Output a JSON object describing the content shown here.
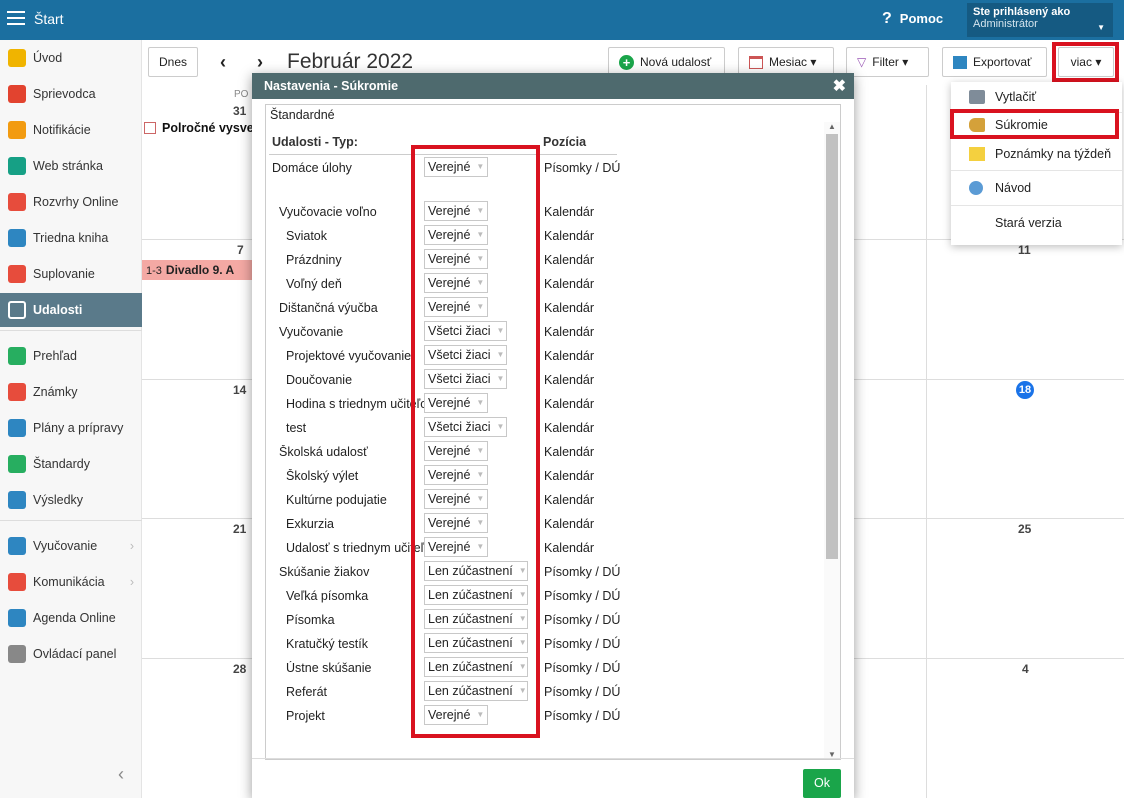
{
  "topbar": {
    "title": "Štart",
    "help": "Pomoc",
    "user_line1": "Ste prihlásený ako",
    "user_line2": "Administrátor"
  },
  "sidebar": {
    "items": [
      {
        "label": "Úvod",
        "icon": "star-icon",
        "color": "#f0b400"
      },
      {
        "label": "Sprievodca",
        "icon": "wand-icon",
        "color": "#e2432f"
      },
      {
        "label": "Notifikácie",
        "icon": "envelope-icon",
        "color": "#f29b11"
      },
      {
        "label": "Web stránka",
        "icon": "house-icon",
        "color": "#16a085"
      },
      {
        "label": "Rozvrhy Online",
        "icon": "grid-icon",
        "color": "#e74c3c"
      },
      {
        "label": "Triedna kniha",
        "icon": "book-icon",
        "color": "#2e86c1"
      },
      {
        "label": "Suplovanie",
        "icon": "person-icon",
        "color": "#e74c3c"
      },
      {
        "label": "Udalosti",
        "icon": "calendar-icon",
        "color": "#ffffff"
      },
      {
        "label": "Prehľad",
        "icon": "check-icon",
        "color": "#27ae60"
      },
      {
        "label": "Známky",
        "icon": "grade-icon",
        "color": "#e74c3c"
      },
      {
        "label": "Plány a prípravy",
        "icon": "briefcase-icon",
        "color": "#2e86c1"
      },
      {
        "label": "Štandardy",
        "icon": "shield-icon",
        "color": "#27ae60"
      },
      {
        "label": "Výsledky",
        "icon": "bar-chart-icon",
        "color": "#2e86c1"
      },
      {
        "label": "Vyučovanie",
        "icon": "open-book-icon",
        "color": "#2e86c1"
      },
      {
        "label": "Komunikácia",
        "icon": "chat-icon",
        "color": "#e74c3c"
      },
      {
        "label": "Agenda Online",
        "icon": "pen-icon",
        "color": "#2e86c1"
      },
      {
        "label": "Ovládací panel",
        "icon": "gear-icon",
        "color": "#888888"
      }
    ]
  },
  "toolbar": {
    "today": "Dnes",
    "month": "Február 2022",
    "new_event": "Nová udalosť",
    "view": "Mesiac ▾",
    "filter": "Filter ▾",
    "export": "Exportovať",
    "more": "viac ▾"
  },
  "calendar": {
    "day_header": "PO",
    "days": [
      "31",
      "7",
      "14",
      "21",
      "28",
      "11",
      "18",
      "25",
      "4"
    ],
    "event1": "Polročné vysve",
    "event2_time": "1-3",
    "event2": "Divadlo 9. A"
  },
  "menu": {
    "items": [
      "Vytlačiť",
      "Súkromie",
      "Poznámky na týždeň",
      "Návod",
      "Stará verzia"
    ]
  },
  "dialog": {
    "title": "Nastavenia - Súkromie",
    "section": "Štandardné",
    "col_type": "Udalosti - Typ:",
    "col_pos": "Pozícia",
    "rows": [
      {
        "label": "Domáce úlohy",
        "value": "Verejné",
        "pos": "Písomky / DÚ"
      },
      {
        "label": "Vyučovacie voľno",
        "value": "Verejné",
        "pos": "Kalendár"
      },
      {
        "label": "Sviatok",
        "value": "Verejné",
        "pos": "Kalendár"
      },
      {
        "label": "Prázdniny",
        "value": "Verejné",
        "pos": "Kalendár"
      },
      {
        "label": "Voľný deň",
        "value": "Verejné",
        "pos": "Kalendár"
      },
      {
        "label": "Dištančná výučba",
        "value": "Verejné",
        "pos": "Kalendár"
      },
      {
        "label": "Vyučovanie",
        "value": "Všetci žiaci",
        "pos": "Kalendár"
      },
      {
        "label": "Projektové vyučovanie",
        "value": "Všetci žiaci",
        "pos": "Kalendár"
      },
      {
        "label": "Doučovanie",
        "value": "Všetci žiaci",
        "pos": "Kalendár"
      },
      {
        "label": "Hodina s triednym učiteľom",
        "value": "Verejné",
        "pos": "Kalendár"
      },
      {
        "label": "test",
        "value": "Všetci žiaci",
        "pos": "Kalendár"
      },
      {
        "label": "Školská udalosť",
        "value": "Verejné",
        "pos": "Kalendár"
      },
      {
        "label": "Školský výlet",
        "value": "Verejné",
        "pos": "Kalendár"
      },
      {
        "label": "Kultúrne podujatie",
        "value": "Verejné",
        "pos": "Kalendár"
      },
      {
        "label": "Exkurzia",
        "value": "Verejné",
        "pos": "Kalendár"
      },
      {
        "label": "Udalosť s triednym učiteľom",
        "value": "Verejné",
        "pos": "Kalendár"
      },
      {
        "label": "Skúšanie žiakov",
        "value": "Len zúčastnení",
        "pos": "Písomky / DÚ"
      },
      {
        "label": "Veľká písomka",
        "value": "Len zúčastnení",
        "pos": "Písomky / DÚ"
      },
      {
        "label": "Písomka",
        "value": "Len zúčastnení",
        "pos": "Písomky / DÚ"
      },
      {
        "label": "Kratučký testík",
        "value": "Len zúčastnení",
        "pos": "Písomky / DÚ"
      },
      {
        "label": "Ústne skúšanie",
        "value": "Len zúčastnení",
        "pos": "Písomky / DÚ"
      },
      {
        "label": "Referát",
        "value": "Len zúčastnení",
        "pos": "Písomky / DÚ"
      },
      {
        "label": "Projekt",
        "value": "Verejné",
        "pos": "Písomky / DÚ"
      }
    ],
    "ok": "Ok"
  }
}
